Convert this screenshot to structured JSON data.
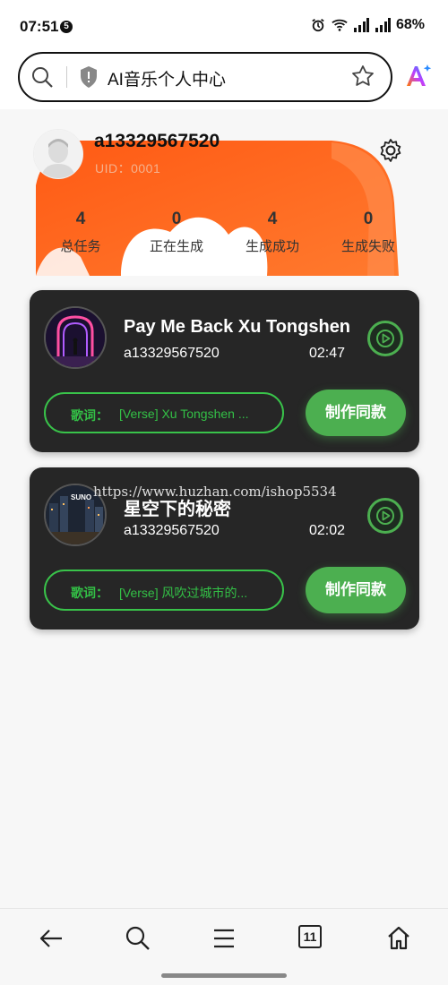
{
  "status_bar": {
    "time": "07:51",
    "notification_count": "5",
    "battery": "68%"
  },
  "address_bar": {
    "title": "AI音乐个人中心"
  },
  "profile": {
    "username": "a13329567520",
    "uid": "UID：0001"
  },
  "stats": [
    {
      "value": "4",
      "label": "总任务"
    },
    {
      "value": "0",
      "label": "正在生成"
    },
    {
      "value": "4",
      "label": "生成成功"
    },
    {
      "value": "0",
      "label": "生成失败"
    }
  ],
  "songs": [
    {
      "title": "Pay Me Back Xu Tongshen",
      "artist": "a13329567520",
      "duration": "02:47",
      "lyrics_label": "歌词：",
      "lyrics_preview": "[Verse] Xu Tongshen ...",
      "action": "制作同款"
    },
    {
      "title": "星空下的秘密",
      "artist": "a13329567520",
      "duration": "02:02",
      "lyrics_label": "歌词：",
      "lyrics_preview": "[Verse] 风吹过城市的...",
      "action": "制作同款",
      "cover_text": "SUNO"
    }
  ],
  "watermark": "https://www.huzhan.com/ishop5534",
  "bottom_nav": {
    "tabs_count": "11"
  },
  "colors": {
    "accent": "#4caf50",
    "card_bg": "#262626",
    "hero_orange": "#ff6a1e"
  }
}
